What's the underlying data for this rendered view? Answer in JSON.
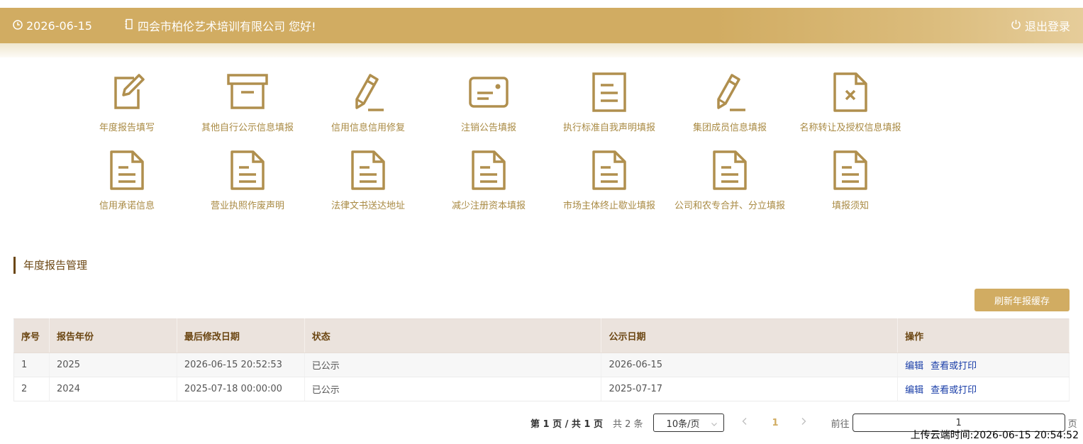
{
  "header": {
    "date": "2026-06-15",
    "greeting": "四会市柏伦艺术培训有限公司 您好!",
    "logout_label": "退出登录"
  },
  "menu": {
    "row1": [
      {
        "label": "年度报告填写",
        "icon": "edit-icon"
      },
      {
        "label": "其他自行公示信息填报",
        "icon": "archive-box-icon"
      },
      {
        "label": "信用信息信用修复",
        "icon": "pencil-icon"
      },
      {
        "label": "注销公告填报",
        "icon": "id-card-icon"
      },
      {
        "label": "执行标准自我声明填报",
        "icon": "document-icon"
      },
      {
        "label": "集团成员信息填报",
        "icon": "pencil-icon"
      },
      {
        "label": "名称转让及授权信息填报",
        "icon": "file-x-icon"
      }
    ],
    "row2": [
      {
        "label": "信用承诺信息",
        "icon": "document-icon"
      },
      {
        "label": "营业执照作废声明",
        "icon": "document-icon"
      },
      {
        "label": "法律文书送达地址",
        "icon": "document-icon"
      },
      {
        "label": "减少注册资本填报",
        "icon": "document-icon"
      },
      {
        "label": "市场主体终止歇业填报",
        "icon": "document-icon"
      },
      {
        "label": "公司和农专合并、分立填报",
        "icon": "document-icon"
      },
      {
        "label": "填报须知",
        "icon": "document-icon"
      }
    ]
  },
  "section": {
    "title": "年度报告管理"
  },
  "refresh_label": "刷新年报缓存",
  "table": {
    "headers": [
      "序号",
      "报告年份",
      "最后修改日期",
      "状态",
      "公示日期",
      "操作"
    ],
    "rows": [
      {
        "no": "1",
        "year": "2025",
        "modified": "2026-06-15 20:52:53",
        "status": "已公示",
        "publish": "2026-06-15",
        "edit": "编辑",
        "view": "查看或打印"
      },
      {
        "no": "2",
        "year": "2024",
        "modified": "2025-07-18 00:00:00",
        "status": "已公示",
        "publish": "2025-07-17",
        "edit": "编辑",
        "view": "查看或打印"
      }
    ]
  },
  "pager": {
    "pages": "第 1 页 / 共 1 页",
    "count": "共 2 条",
    "size": "10条/页",
    "current": "1",
    "goto": "前往",
    "goto_value": "1",
    "unit": "页"
  },
  "upload_time": "上传云端时间:2026-06-15 20:54:52",
  "colors": {
    "gold": "#d1ac62",
    "icon": "#b08f4e",
    "brown": "#6b4612",
    "link": "#1a3ea8"
  }
}
